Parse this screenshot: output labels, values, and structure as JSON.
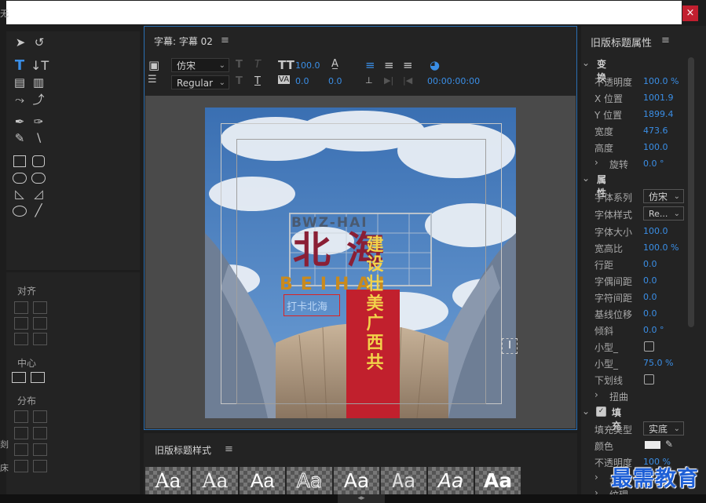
{
  "window": {
    "close_label": "×",
    "left_cut_char": "无"
  },
  "tools_panel": {
    "align_title": "对齐",
    "center_title": "中心",
    "distribute_title": "分布"
  },
  "left_edge_chars": [
    "剡",
    "床"
  ],
  "title_panel": {
    "tab_label": "字幕: 字幕 02",
    "menu_icon": "≡",
    "font_family": "仿宋",
    "font_style": "Regular",
    "font_size": "100.0",
    "kerning": "0.0",
    "leading": "0.0",
    "timecode": "00:00:00:00",
    "caption_text": "打卡北海",
    "sign_top": "BWZ-HAI",
    "sign_chinese": "北海",
    "sign_pinyin": "BEIHAI",
    "banner_text": "建设壮美广西共"
  },
  "styles_panel": {
    "tab_label": "旧版标题样式",
    "menu_icon": "≡",
    "swatch_labels": [
      "Aa",
      "Aa",
      "Aa",
      "Aa",
      "Aa",
      "Aa",
      "Aa",
      "Aa"
    ]
  },
  "properties_panel": {
    "title": "旧版标题属性",
    "menu_icon": "≡",
    "transform_section": "变换",
    "transform_rows": [
      {
        "label": "不透明度",
        "value": "100.0 %"
      },
      {
        "label": "X 位置",
        "value": "1001.9"
      },
      {
        "label": "Y 位置",
        "value": "1899.4"
      },
      {
        "label": "宽度",
        "value": "473.6"
      },
      {
        "label": "高度",
        "value": "100.0"
      }
    ],
    "rotation": {
      "label": "旋转",
      "value": "0.0 °"
    },
    "attributes_section": "属性",
    "font_family_label": "字体系列",
    "font_family_value": "仿宋",
    "font_style_label": "字体样式",
    "font_style_value": "Re...",
    "attr_rows": [
      {
        "label": "字体大小",
        "value": "100.0"
      },
      {
        "label": "宽高比",
        "value": "100.0 %"
      },
      {
        "label": "行距",
        "value": "0.0"
      },
      {
        "label": "字偶间距",
        "value": "0.0"
      },
      {
        "label": "字符间距",
        "value": "0.0"
      },
      {
        "label": "基线位移",
        "value": "0.0"
      },
      {
        "label": "倾斜",
        "value": "0.0 °"
      }
    ],
    "smallcaps_label": "小型_",
    "smallcaps_size_label": "小型_",
    "smallcaps_size_value": "75.0 %",
    "underline_label": "下划线",
    "distort_label": "扭曲",
    "fill_section": "填充",
    "fill_type_label": "填充类型",
    "fill_type_value": "实底",
    "color_label": "颜色",
    "fill_color": "#ececec",
    "fill_opacity_label": "不透明度",
    "fill_opacity_value": "100 %",
    "gloss_label": "光泽",
    "texture_label": "纹理"
  },
  "watermark": "最需教育",
  "colors": {
    "accent": "#3a8ee6",
    "selection_border": "#2a6fb3",
    "close": "#c21f2f"
  }
}
